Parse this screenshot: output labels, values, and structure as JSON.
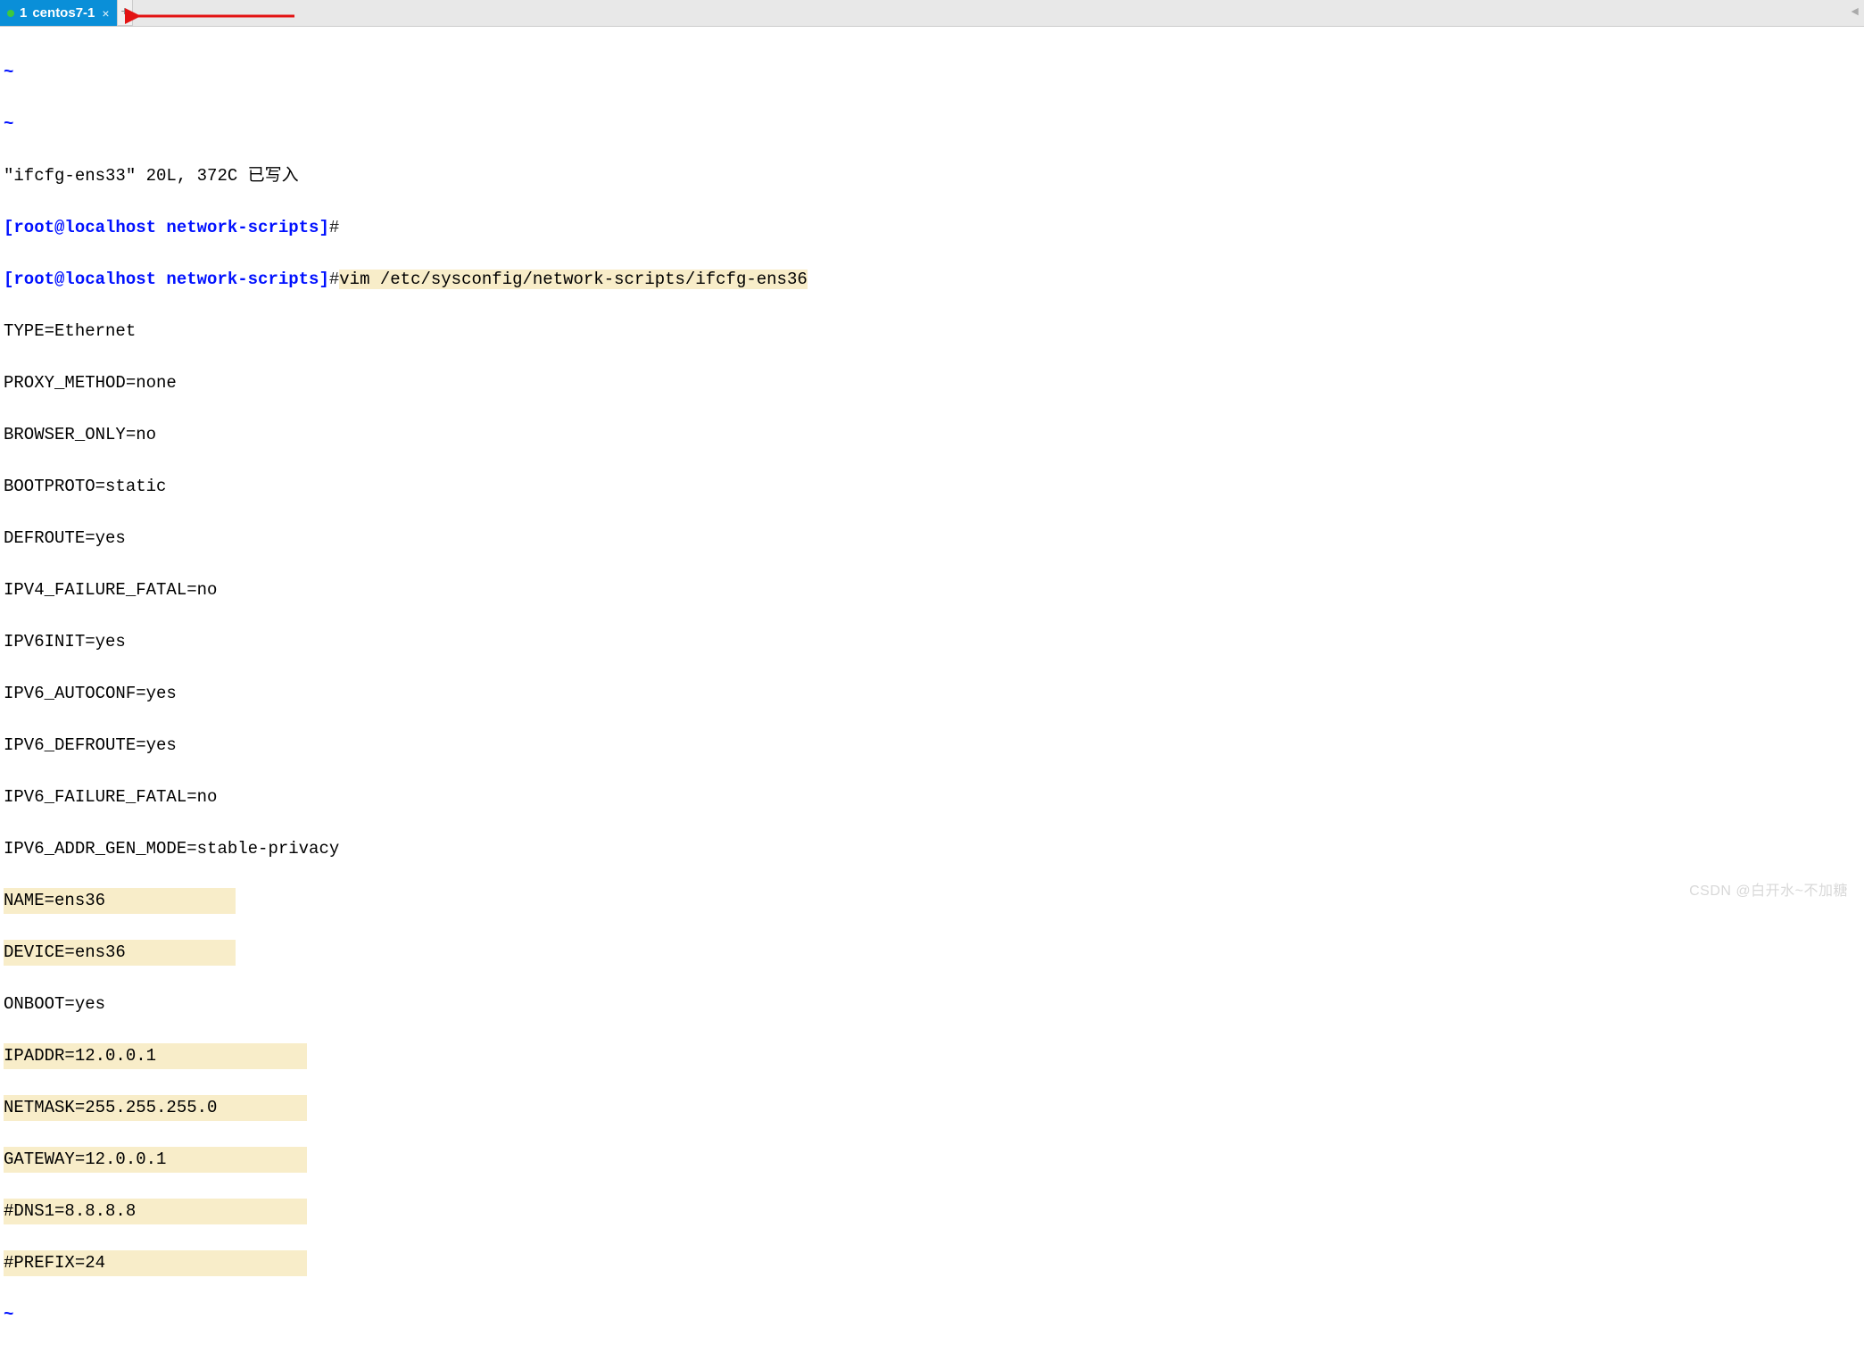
{
  "tabbar": {
    "tab_number": "1",
    "tab_label": "centos7-1",
    "close_glyph": "×",
    "add_glyph": "+",
    "scroll_left_glyph": "◄"
  },
  "terminal": {
    "tilde": "~",
    "status_line": "\"ifcfg-ens33\" 20L, 372C 已写入",
    "prompt1": "[root@localhost network-scripts]",
    "hash": "#",
    "prompt2": "[root@localhost network-scripts]",
    "cmd": "vim /etc/sysconfig/network-scripts/ifcfg-ens36",
    "lines": {
      "l1": "TYPE=Ethernet",
      "l2": "PROXY_METHOD=none",
      "l3": "BROWSER_ONLY=no",
      "l4": "BOOTPROTO=static",
      "l5": "DEFROUTE=yes",
      "l6": "IPV4_FAILURE_FATAL=no",
      "l7": "IPV6INIT=yes",
      "l8": "IPV6_AUTOCONF=yes",
      "l9": "IPV6_DEFROUTE=yes",
      "l10": "IPV6_FAILURE_FATAL=no",
      "l11": "IPV6_ADDR_GEN_MODE=stable-privacy",
      "l12": "NAME=ens36",
      "l13": "DEVICE=ens36",
      "l14": "ONBOOT=yes",
      "l15": "IPADDR=12.0.0.1",
      "l16": "NETMASK=255.255.255.0",
      "l17": "GATEWAY=12.0.0.1",
      "l18": "#DNS1=8.8.8.8",
      "l19": "#PREFIX=24"
    }
  },
  "watermark": "CSDN @白开水~不加糖",
  "colors": {
    "tab_bg": "#0a8fd8",
    "arrow": "#e31313",
    "highlight": "#f8edc9",
    "prompt": "#0010ff"
  }
}
